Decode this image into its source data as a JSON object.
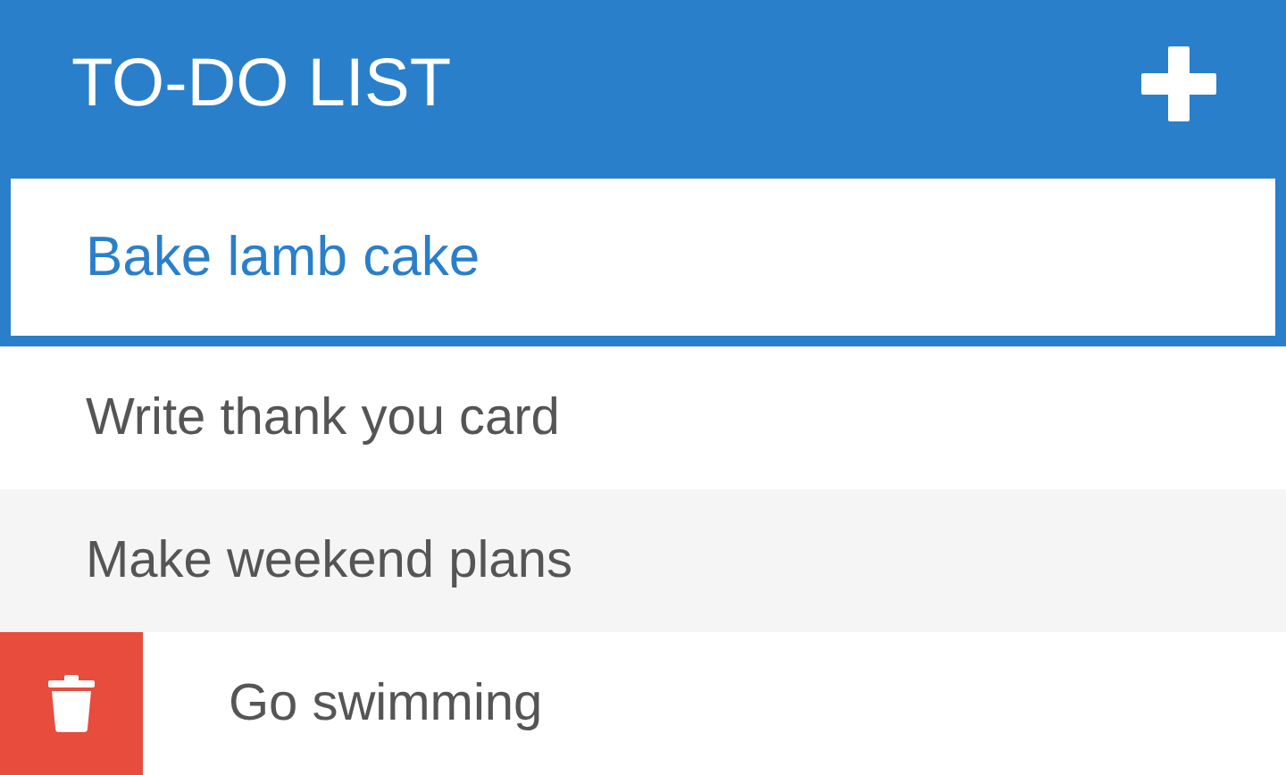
{
  "header": {
    "title": "TO-DO LIST"
  },
  "items": [
    {
      "text": "Bake lamb cake",
      "selected": true,
      "swiped": false
    },
    {
      "text": "Write thank you card",
      "selected": false,
      "swiped": false
    },
    {
      "text": "Make weekend plans",
      "selected": false,
      "swiped": false
    },
    {
      "text": "Go swimming",
      "selected": false,
      "swiped": true
    }
  ]
}
